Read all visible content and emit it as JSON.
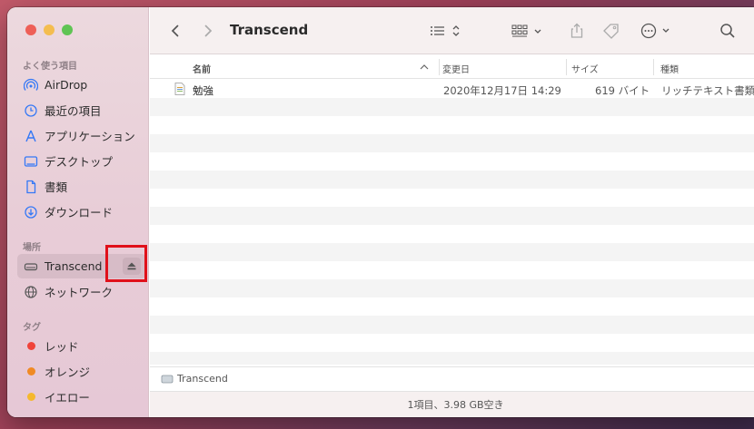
{
  "sidebar": {
    "favorites_title": "よく使う項目",
    "favorites": [
      {
        "label": "AirDrop",
        "icon": "airdrop-icon"
      },
      {
        "label": "最近の項目",
        "icon": "clock-icon"
      },
      {
        "label": "アプリケーション",
        "icon": "applications-icon"
      },
      {
        "label": "デスクトップ",
        "icon": "desktop-icon"
      },
      {
        "label": "書類",
        "icon": "document-icon"
      },
      {
        "label": "ダウンロード",
        "icon": "download-icon"
      }
    ],
    "locations_title": "場所",
    "locations": [
      {
        "label": "Transcend",
        "icon": "external-drive-icon",
        "selected": true
      },
      {
        "label": "ネットワーク",
        "icon": "globe-icon"
      }
    ],
    "tags_title": "タグ",
    "tags": [
      {
        "label": "レッド",
        "color": "#f0433a"
      },
      {
        "label": "オレンジ",
        "color": "#f08a24"
      },
      {
        "label": "イエロー",
        "color": "#f5b82e"
      }
    ]
  },
  "toolbar": {
    "title": "Transcend"
  },
  "columns": {
    "name": "名前",
    "date": "変更日",
    "size": "サイズ",
    "kind": "種類"
  },
  "files": [
    {
      "name": "勉強",
      "date": "2020年12月17日 14:29",
      "size": "619 バイト",
      "kind": "リッチテキスト書類"
    }
  ],
  "pathbar": {
    "label": "Transcend"
  },
  "status": {
    "text": "1項目、3.98 GB空き"
  },
  "colors": {
    "accent": "#3478f6",
    "highlight": "#e0101a"
  }
}
